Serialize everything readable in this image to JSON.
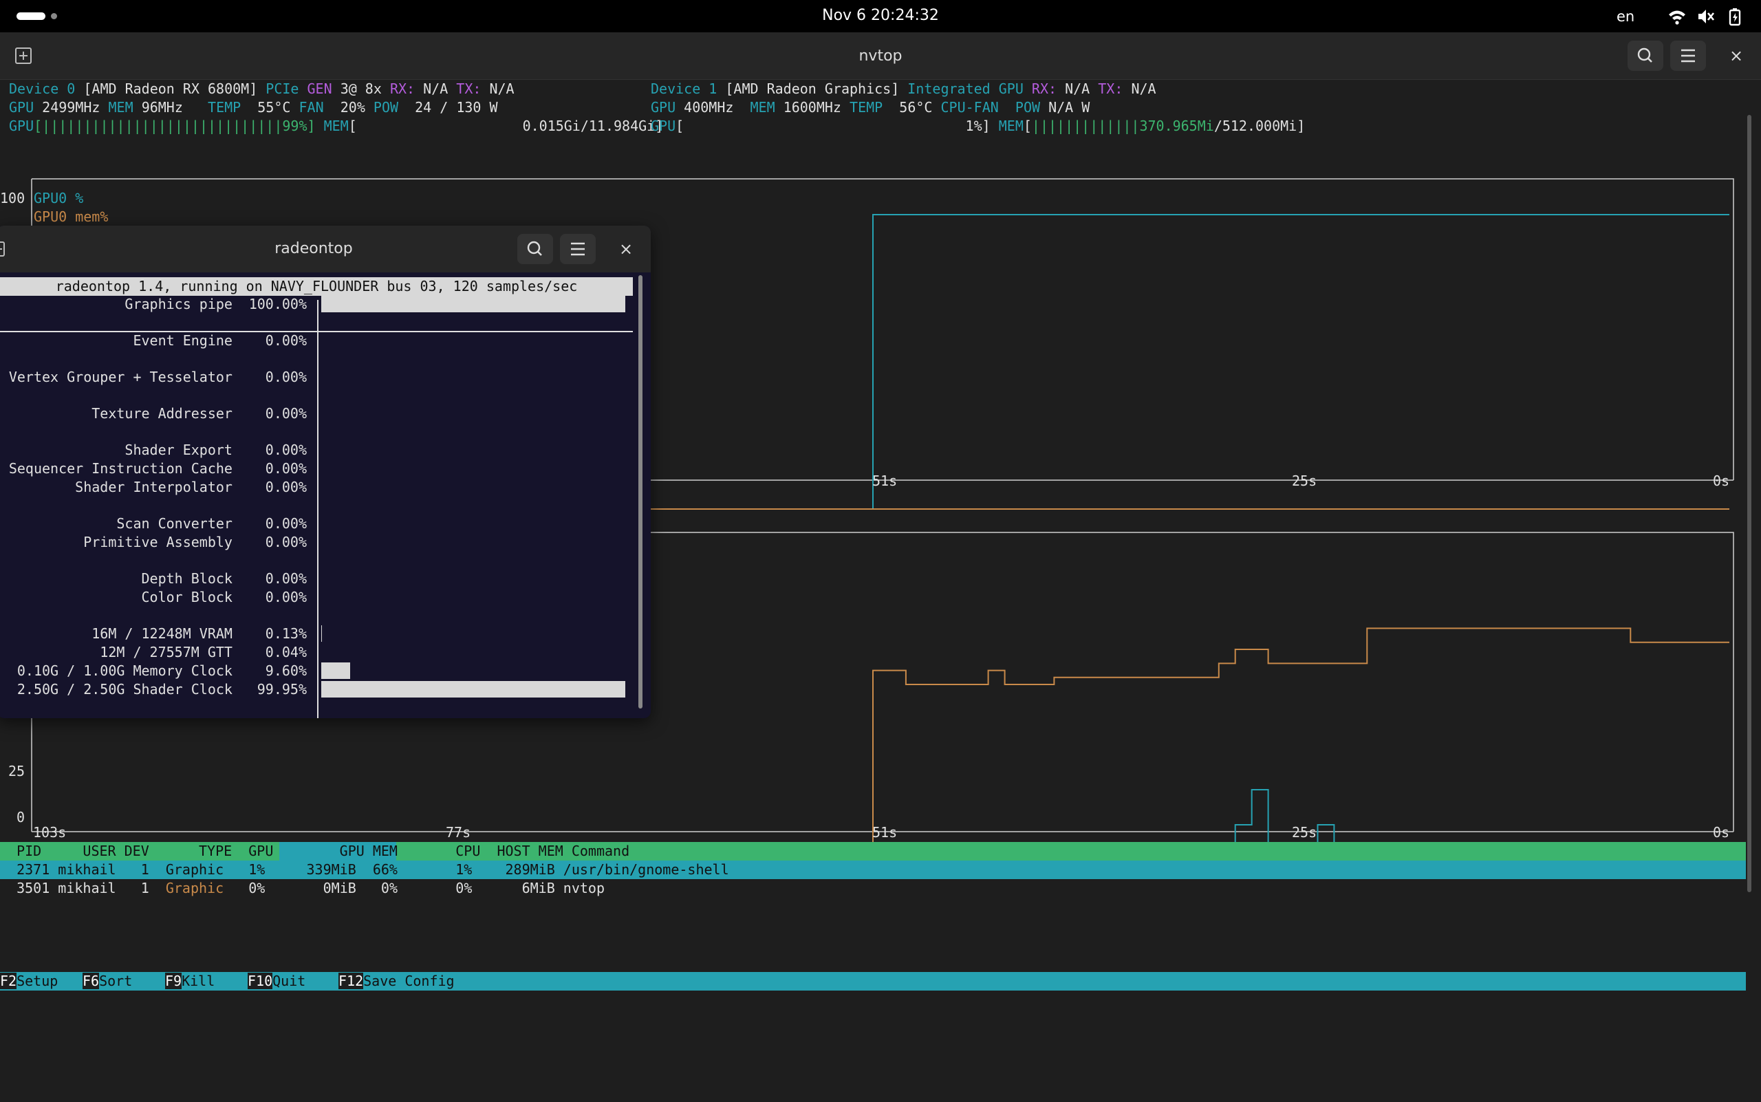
{
  "topbar": {
    "clock": "Nov 6  20:24:32",
    "lang": "en",
    "icons": [
      "wifi-icon",
      "volume-muted-icon",
      "battery-icon"
    ]
  },
  "nvtop_window": {
    "title": "nvtop",
    "device0": {
      "line1": {
        "dev": "Device 0",
        "name": "[AMD Radeon RX 6800M]",
        "pcie_lbl": "PCIe",
        "gen_lbl": "GEN",
        "gen_val": "3@ 8x",
        "rx_lbl": "RX:",
        "rx_val": "N/A",
        "tx_lbl": "TX:",
        "tx_val": "N/A"
      },
      "line2": {
        "gpu_lbl": "GPU",
        "gpu_val": "2499MHz",
        "mem_lbl": "MEM",
        "mem_val": "96MHz",
        "temp_lbl": "TEMP",
        "temp_val": "55°C",
        "fan_lbl": "FAN",
        "fan_val": "20%",
        "pow_lbl": "POW",
        "pow_val": "24 / 130 W"
      },
      "line3": {
        "gpu_lbl": "GPU",
        "gpu_bar": "[|||||||||||||||||||||||||||||99%]",
        "mem_lbl": "MEM",
        "mem_bar": "[                    0.015Gi/11.984Gi]"
      }
    },
    "device1": {
      "line1": {
        "dev": "Device 1",
        "name": "[AMD Radeon Graphics]",
        "integ": "Integrated GPU",
        "rx_lbl": "RX:",
        "rx_val": "N/A",
        "tx_lbl": "TX:",
        "tx_val": "N/A"
      },
      "line2": {
        "gpu_lbl": "GPU",
        "gpu_val": "400MHz",
        "mem_lbl": "MEM",
        "mem_val": "1600MHz",
        "temp_lbl": "TEMP",
        "temp_val": "56°C",
        "cpufan_lbl": "CPU-FAN",
        "pow_lbl": "POW",
        "pow_val": "N/A W"
      },
      "line3": {
        "gpu_lbl": "GPU",
        "gpu_bar": "[                                  1%]",
        "mem_lbl": "MEM",
        "mem_bar_open": "[",
        "mem_bar_fill": "|||||||||||||370.965Mi",
        "mem_bar_total": "/512.000Mi]"
      }
    },
    "graph1": {
      "y_top": "100",
      "legend": [
        "GPU0 %",
        "GPU0 mem%"
      ],
      "x_ticks": [
        "51s",
        "25s",
        "0s"
      ]
    },
    "graph2": {
      "y_ticks": [
        "25",
        "0"
      ],
      "x_ticks": [
        "103s",
        "77s",
        "51s",
        "25s",
        "0s"
      ]
    },
    "process_table": {
      "header": "  PID     USER DEV      TYPE  GPU        GPU MEM       CPU  HOST MEM Command",
      "rows": [
        "  2371 mikhail   1  Graphic   1%     339MiB  66%       1%    289MiB /usr/bin/gnome-shell",
        "  3501 mikhail   1  Graphic   0%       0MiB   0%       0%      6MiB nvtop"
      ],
      "row2_parts": {
        "pre": "  3501 mikhail   1  ",
        "type": "Graphic",
        "post": "   0%       0MiB   0%       0%      6MiB nvtop"
      }
    },
    "fkeys": [
      {
        "key": "F2",
        "label": "Setup  "
      },
      {
        "key": "F6",
        "label": "Sort   "
      },
      {
        "key": "F9",
        "label": "Kill   "
      },
      {
        "key": "F10",
        "label": "Quit   "
      },
      {
        "key": "F12",
        "label": "Save Config"
      }
    ]
  },
  "chart_data": [
    {
      "type": "line",
      "title": "",
      "xlabel": "",
      "ylabel": "",
      "x_range_seconds_ago": [
        103,
        0
      ],
      "ylim": [
        0,
        100
      ],
      "series": [
        {
          "name": "GPU0 %",
          "color": "#26a2b2",
          "x": [
            103,
            52,
            52,
            0
          ],
          "y": [
            0,
            0,
            100,
            100
          ]
        },
        {
          "name": "GPU0 mem%",
          "color": "#c98a4a",
          "x": [
            103,
            0
          ],
          "y": [
            0,
            0
          ]
        }
      ]
    },
    {
      "type": "line",
      "title": "",
      "xlabel": "",
      "ylabel": "",
      "x_range_seconds_ago": [
        103,
        0
      ],
      "ylim": [
        0,
        40
      ],
      "series": [
        {
          "name": "",
          "color": "#c98a4a",
          "x": [
            103,
            52,
            52,
            50,
            50,
            45,
            45,
            44,
            44,
            41,
            41,
            31,
            31,
            30,
            30,
            28,
            28,
            22,
            22,
            6,
            6,
            0
          ],
          "y": [
            0,
            0,
            27,
            27,
            25,
            25,
            27,
            27,
            25,
            25,
            26,
            26,
            28,
            28,
            30,
            30,
            28,
            28,
            33,
            33,
            31,
            31
          ]
        },
        {
          "name": "",
          "color": "#26a2b2",
          "x": [
            103,
            41,
            41,
            39,
            39,
            38,
            38,
            34,
            34,
            32,
            32,
            30,
            30,
            29,
            29,
            28,
            28,
            26,
            26,
            25,
            25,
            24,
            24,
            23,
            23,
            22,
            22,
            15,
            15,
            3,
            3,
            2,
            2,
            0
          ],
          "y": [
            0,
            0,
            2,
            2,
            0,
            0,
            2,
            2,
            0,
            0,
            2,
            2,
            5,
            5,
            10,
            10,
            2,
            2,
            0,
            0,
            5,
            5,
            2,
            2,
            0,
            0,
            0,
            0,
            0,
            0,
            2,
            2,
            0,
            0
          ]
        }
      ]
    }
  ],
  "radeontop_window": {
    "title": "radeontop",
    "status": "radeontop 1.4, running on NAVY_FLOUNDER bus 03, 120 samples/sec",
    "rows": [
      {
        "label": "Graphics pipe",
        "value": "100.00%",
        "fraction": 1.0
      },
      {
        "label": "Event Engine",
        "value": "0.00%",
        "fraction": 0
      },
      {
        "label": "Vertex Grouper + Tesselator",
        "value": "0.00%",
        "fraction": 0
      },
      {
        "label": "Texture Addresser",
        "value": "0.00%",
        "fraction": 0
      },
      {
        "label": "Shader Export",
        "value": "0.00%",
        "fraction": 0
      },
      {
        "label": "Sequencer Instruction Cache",
        "value": "0.00%",
        "fraction": 0
      },
      {
        "label": "Shader Interpolator",
        "value": "0.00%",
        "fraction": 0
      },
      {
        "label": "Scan Converter",
        "value": "0.00%",
        "fraction": 0
      },
      {
        "label": "Primitive Assembly",
        "value": "0.00%",
        "fraction": 0
      },
      {
        "label": "Depth Block",
        "value": "0.00%",
        "fraction": 0
      },
      {
        "label": "Color Block",
        "value": "0.00%",
        "fraction": 0
      },
      {
        "label": "16M / 12248M VRAM",
        "value": "0.13%",
        "fraction": 0.0013
      },
      {
        "label": "12M / 27557M GTT",
        "value": "0.04%",
        "fraction": 0.0004
      },
      {
        "label": "0.10G / 1.00G Memory Clock",
        "value": "9.60%",
        "fraction": 0.096
      },
      {
        "label": "2.50G / 2.50G Shader Clock",
        "value": "99.95%",
        "fraction": 0.9995
      }
    ]
  }
}
